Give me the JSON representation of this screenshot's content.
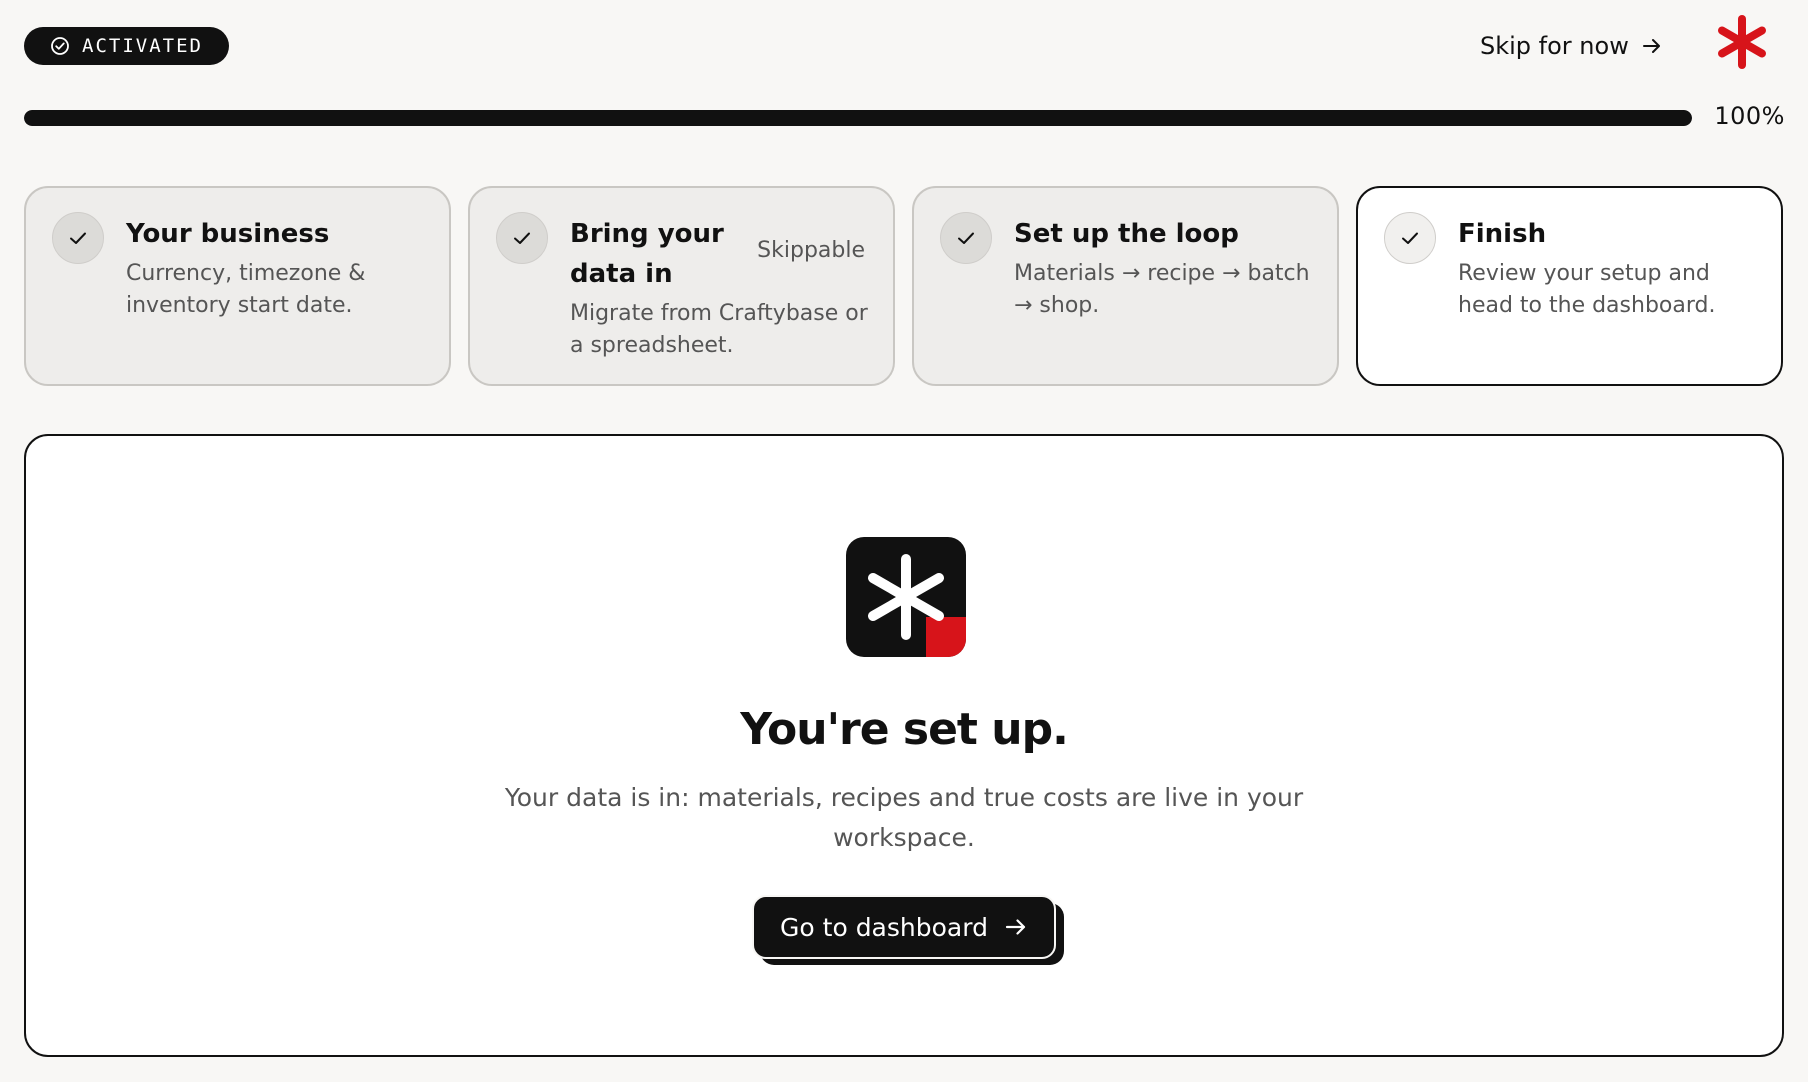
{
  "header": {
    "status_badge": "ACTIVATED",
    "skip_label": "Skip for now"
  },
  "progress": {
    "percent_label": "100%",
    "fraction": 1.0
  },
  "steps": [
    {
      "title": "Your business",
      "description": "Currency, timezone & inventory start date.",
      "state": "complete"
    },
    {
      "title": "Bring your data in",
      "description": "Migrate from Craftybase or a spreadsheet.",
      "tag": "Skippable",
      "state": "complete"
    },
    {
      "title": "Set up the loop",
      "description": "Materials → recipe → batch → shop.",
      "state": "complete"
    },
    {
      "title": "Finish",
      "description": "Review your setup and head to the dashboard.",
      "state": "current"
    }
  ],
  "main": {
    "headline": "You're set up.",
    "subtext": "Your data is in: materials, recipes and true costs are live in your workspace.",
    "cta_label": "Go to dashboard"
  },
  "colors": {
    "accent": "#d7141a",
    "ink": "#111111",
    "background": "#f8f7f5"
  },
  "icons": {
    "badge": "check-circle-icon",
    "skip": "arrow-right-icon",
    "brand": "asterisk-logo-icon",
    "step": "check-icon",
    "cta": "arrow-right-icon"
  }
}
